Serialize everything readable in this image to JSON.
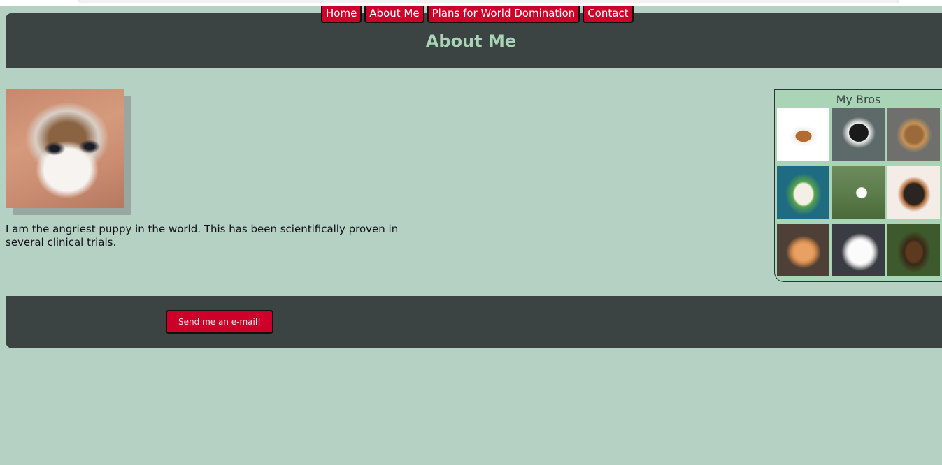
{
  "nav": {
    "items": [
      {
        "label": "Home"
      },
      {
        "label": "About Me"
      },
      {
        "label": "Plans for World Domination"
      },
      {
        "label": "Contact"
      }
    ]
  },
  "header": {
    "title": "About Me"
  },
  "main": {
    "bio": "I am the angriest puppy in the world. This has been scientifically proven in several clinical trials."
  },
  "sidebar": {
    "title": "My Bros",
    "bros": [
      "puppy",
      "puppy",
      "puppy",
      "puppy",
      "puppy",
      "puppy",
      "puppy",
      "puppy",
      "ewok"
    ]
  },
  "footer": {
    "email_button_label": "Send me an e-mail!"
  },
  "colors": {
    "background": "#b5d1c4",
    "panel": "#3b4443",
    "accent": "#cc0029",
    "title": "#a9d4b6"
  }
}
